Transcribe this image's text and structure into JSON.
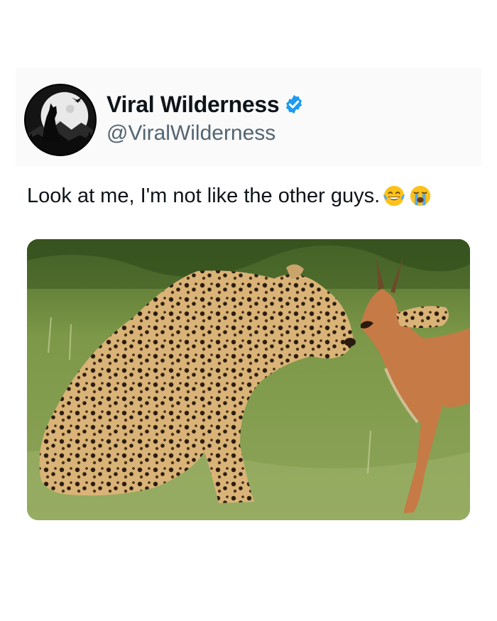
{
  "post": {
    "display_name": "Viral Wilderness",
    "handle": "@ViralWilderness",
    "verified": true,
    "text": "Look at me, I'm not like the other guys.",
    "emojis": [
      "face-with-tears-of-joy",
      "loudly-crying-face"
    ]
  },
  "colors": {
    "badge": "#1d9bf0",
    "handle": "#536471",
    "text": "#0f1419"
  },
  "icons": {
    "avatar": "howling-wolf-moon-logo",
    "badge": "verified-check-icon"
  }
}
